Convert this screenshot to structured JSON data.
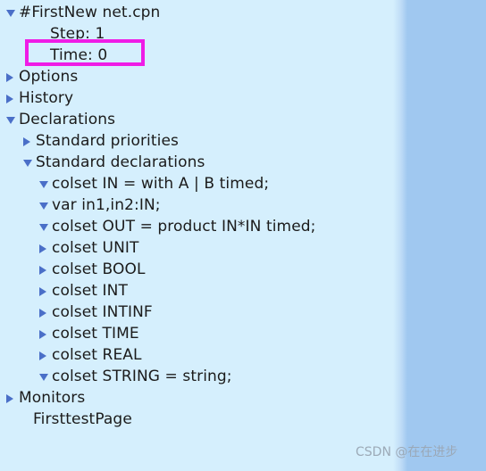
{
  "colors": {
    "background": "#d5effd",
    "panel": "#a0c8f0",
    "twisty": "#4a6fc8",
    "highlight_border": "#ef1ce6",
    "text": "#1b1b1b",
    "watermark": "#9aa7b4"
  },
  "tree": {
    "rows": [
      {
        "label": "#FirstNew net.cpn",
        "level": 0,
        "twisty": "expanded"
      },
      {
        "label": "Step: 1",
        "level": 1,
        "twisty": "none"
      },
      {
        "label": "Time: 0",
        "level": 1,
        "twisty": "none"
      },
      {
        "label": "Options",
        "level": 0,
        "twisty": "collapsed"
      },
      {
        "label": "History",
        "level": 0,
        "twisty": "collapsed"
      },
      {
        "label": "Declarations",
        "level": 0,
        "twisty": "expanded"
      },
      {
        "label": "Standard priorities",
        "level": 1,
        "twisty": "collapsed"
      },
      {
        "label": "Standard declarations",
        "level": 1,
        "twisty": "expanded"
      },
      {
        "label": "colset IN = with A | B timed;",
        "level": 2,
        "twisty": "expanded"
      },
      {
        "label": "var in1,in2:IN;",
        "level": 2,
        "twisty": "expanded"
      },
      {
        "label": "colset OUT = product IN*IN timed;",
        "level": 2,
        "twisty": "expanded"
      },
      {
        "label": "colset UNIT",
        "level": 2,
        "twisty": "collapsed"
      },
      {
        "label": "colset BOOL",
        "level": 2,
        "twisty": "collapsed"
      },
      {
        "label": "colset INT",
        "level": 2,
        "twisty": "collapsed"
      },
      {
        "label": "colset INTINF",
        "level": 2,
        "twisty": "collapsed"
      },
      {
        "label": "colset TIME",
        "level": 2,
        "twisty": "collapsed"
      },
      {
        "label": "colset REAL",
        "level": 2,
        "twisty": "collapsed"
      },
      {
        "label": "colset STRING = string;",
        "level": 2,
        "twisty": "expanded"
      },
      {
        "label": "Monitors",
        "level": 0,
        "twisty": "collapsed"
      },
      {
        "label": "FirsttestPage",
        "level": 0,
        "twisty": "none"
      }
    ]
  },
  "annotation": {
    "highlight_target": "Time: 0"
  },
  "watermark": {
    "text": "CSDN @在在进步"
  }
}
